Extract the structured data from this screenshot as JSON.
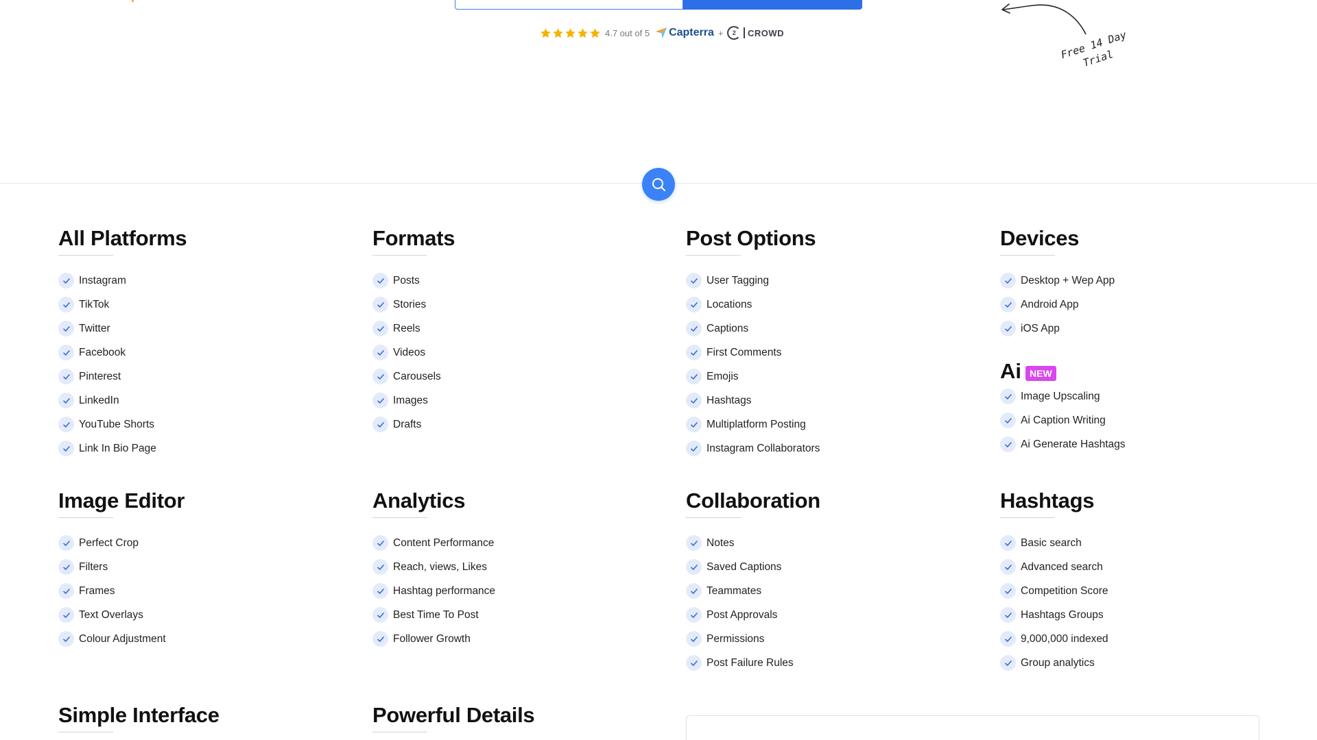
{
  "hero": {
    "rating_text": "4.7 out of 5",
    "capterra_label": "Capterra",
    "plus": "+",
    "g2_mark": "2",
    "g2_label": "CROWD",
    "trial_line1": "Free 14 Day",
    "trial_line2": "Trial"
  },
  "sections": {
    "all_platforms": {
      "title": "All Platforms",
      "items": [
        "Instagram",
        "TikTok",
        "Twitter",
        "Facebook",
        "Pinterest",
        "LinkedIn",
        "YouTube Shorts",
        "Link In Bio Page"
      ]
    },
    "formats": {
      "title": "Formats",
      "items": [
        "Posts",
        "Stories",
        "Reels",
        "Videos",
        "Carousels",
        "Images",
        "Drafts"
      ]
    },
    "post_options": {
      "title": "Post Options",
      "items": [
        "User Tagging",
        "Locations",
        "Captions",
        "First Comments",
        "Emojis",
        "Hashtags",
        "Multiplatform Posting",
        "Instagram Collaborators"
      ]
    },
    "devices": {
      "title": "Devices",
      "items": [
        "Desktop + Wep App",
        "Android App",
        "iOS App"
      ]
    },
    "ai": {
      "title": "Ai",
      "badge": "NEW",
      "items": [
        "Image Upscaling",
        "Ai Caption Writing",
        "Ai Generate Hashtags"
      ]
    },
    "image_editor": {
      "title": "Image Editor",
      "items": [
        "Perfect Crop",
        "Filters",
        "Frames",
        "Text Overlays",
        "Colour Adjustment"
      ]
    },
    "analytics": {
      "title": "Analytics",
      "items": [
        "Content Performance",
        "Reach, views, Likes",
        "Hashtag performance",
        "Best Time To Post",
        "Follower Growth"
      ]
    },
    "collaboration": {
      "title": "Collaboration",
      "items": [
        "Notes",
        "Saved Captions",
        "Teammates",
        "Post Approvals",
        "Permissions",
        "Post Failure Rules"
      ]
    },
    "hashtags": {
      "title": "Hashtags",
      "items": [
        "Basic search",
        "Advanced search",
        "Competition Score",
        "Hashtags Groups",
        "9,000,000 indexed",
        "Group analytics"
      ]
    },
    "simple_interface": {
      "title": "Simple Interface"
    },
    "powerful_details": {
      "title": "Powerful Details"
    }
  },
  "colors": {
    "accent": "#3b82f6",
    "check_bg": "#e3ebfa",
    "badge": "#d946ef",
    "star": "#f5b301"
  },
  "icons": {
    "search": "search-icon",
    "check": "check-icon",
    "star": "star-icon"
  }
}
